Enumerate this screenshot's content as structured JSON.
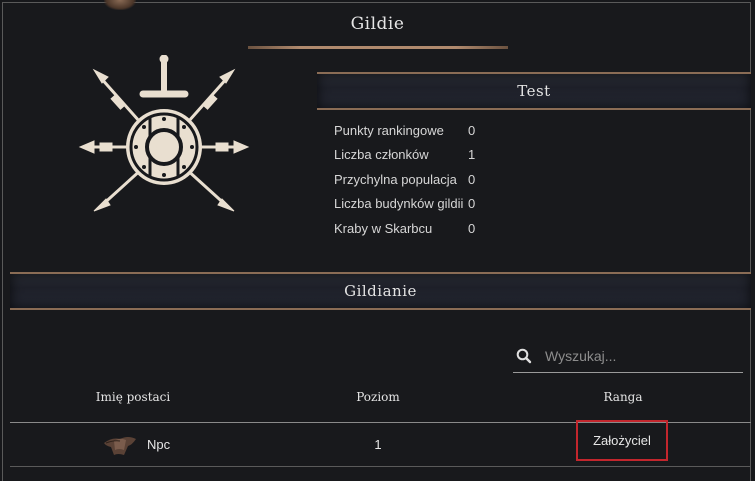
{
  "page": {
    "title": "Gildie"
  },
  "guild": {
    "name": "Test",
    "stats": [
      {
        "label": "Punkty rankingowe",
        "value": "0"
      },
      {
        "label": "Liczba członków",
        "value": "1"
      },
      {
        "label": "Przychylna populacja",
        "value": "0"
      },
      {
        "label": "Liczba budynków gildii",
        "value": "0"
      },
      {
        "label": "Kraby w Skarbcu",
        "value": "0"
      }
    ]
  },
  "members": {
    "heading": "Gildianie",
    "search": {
      "placeholder": "Wyszukaj...",
      "value": ""
    },
    "columns": {
      "name": "Imię postaci",
      "level": "Poziom",
      "rank": "Ranga"
    },
    "rows": [
      {
        "name": "Npc",
        "level": "1",
        "rank": "Założyciel"
      }
    ]
  },
  "colors": {
    "background": "#18191c",
    "accent_bronze": "#8a6c55",
    "highlight_red": "#c3262d",
    "emblem": "#e9dfd0"
  },
  "icons": {
    "emblem": "guild-emblem-shield-sword-spears",
    "search": "search-icon",
    "avatar": "member-hat-avatar"
  }
}
